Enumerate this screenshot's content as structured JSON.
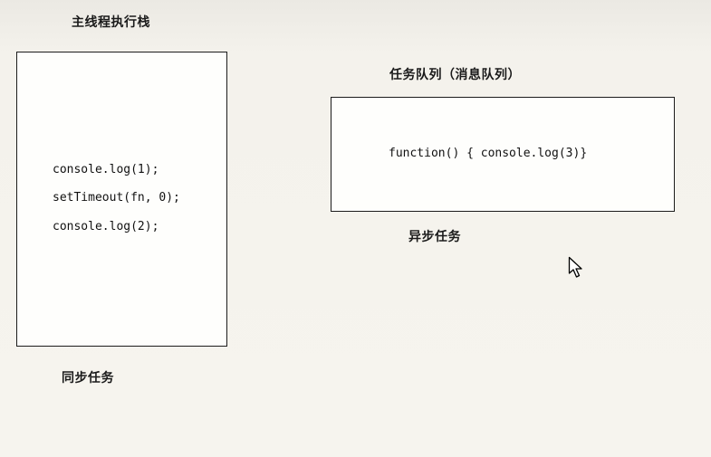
{
  "main_stack": {
    "title": "主线程执行栈",
    "code_lines": [
      "console.log(1);",
      "setTimeout(fn, 0);",
      "console.log(2);"
    ],
    "caption": "同步任务"
  },
  "task_queue": {
    "title": "任务队列（消息队列）",
    "item": "function() {  console.log(3)}",
    "caption": "异步任务"
  },
  "colors": {
    "background": "#f4f2ec",
    "box_fill": "#fefefc",
    "border": "#1c1c1c"
  },
  "icons": {
    "cursor": "mouse-pointer-icon"
  }
}
